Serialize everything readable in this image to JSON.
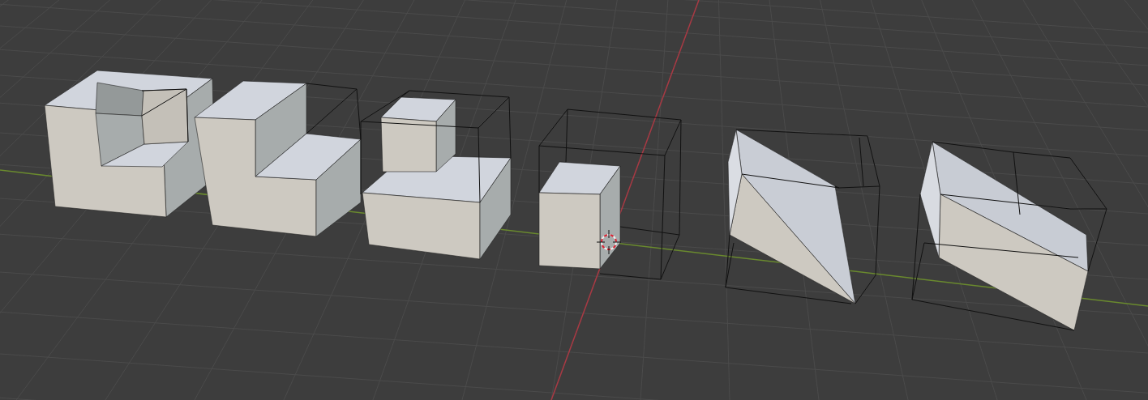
{
  "viewport": {
    "objects": [
      {
        "kind": "hollow-cube"
      },
      {
        "kind": "l-block"
      },
      {
        "kind": "stepped-block"
      },
      {
        "kind": "small-block"
      },
      {
        "kind": "wedge"
      },
      {
        "kind": "slanted-prism"
      }
    ]
  }
}
